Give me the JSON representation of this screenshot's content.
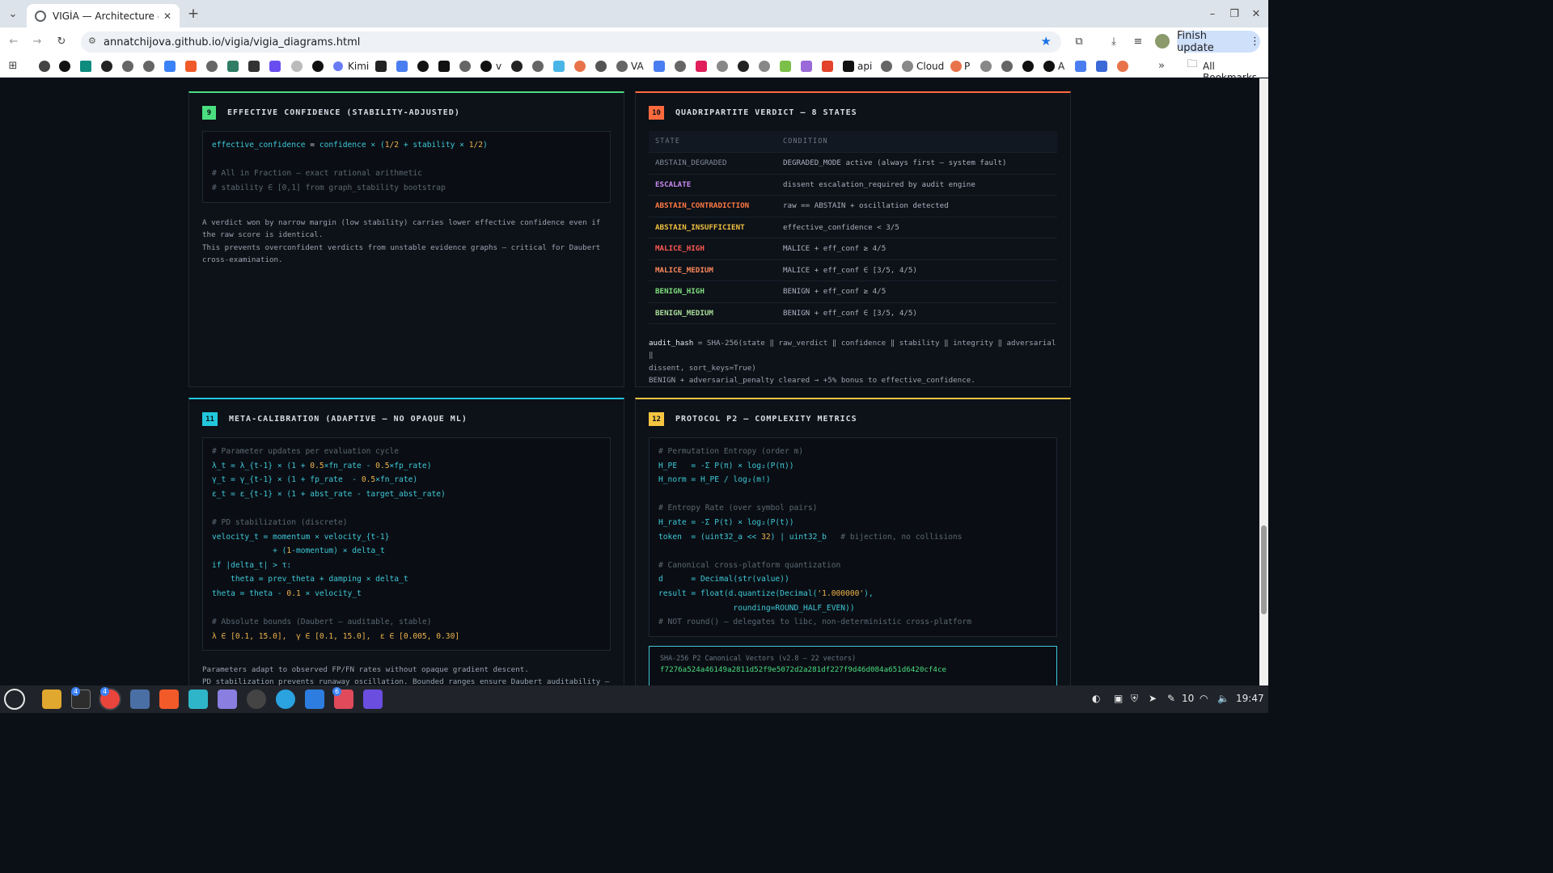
{
  "browser": {
    "tab_title": "VIGÍA — Architecture & Math",
    "url": "annatchijova.github.io/vigia/vigia_diagrams.html",
    "finish_update": "Finish update",
    "all_bookmarks": "All Bookmarks",
    "bookmarks": [
      "Kimi",
      "v",
      "VA",
      "P",
      "api",
      "Cloud",
      "A"
    ]
  },
  "panel9": {
    "num": "9",
    "title": "EFFECTIVE CONFIDENCE (STABILITY-ADJUSTED)",
    "code": {
      "l1a": "effective_confidence",
      "l1b": " = ",
      "l1c": "confidence × (",
      "l1d": "1/2",
      "l1e": " + stability × ",
      "l1f": "1/2",
      "l1g": ")",
      "c1": "# All in Fraction — exact rational arithmetic",
      "c2": "# stability ∈ [0,1] from graph_stability bootstrap"
    },
    "desc1": "A verdict won by narrow margin (low stability) carries lower effective confidence even if the raw score is identical.",
    "desc2": "This prevents overconfident verdicts from unstable evidence graphs — critical for Daubert cross-examination."
  },
  "panel10": {
    "num": "10",
    "title": "QUADRIPARTITE VERDICT — 8 STATES",
    "col_state": "STATE",
    "col_condition": "CONDITION",
    "rows": [
      {
        "state": "ABSTAIN_DEGRADED",
        "condition": "DEGRADED_MODE active (always first — system fault)",
        "color": "#7f8a99"
      },
      {
        "state": "ESCALATE",
        "condition": "dissent escalation_required by audit engine",
        "color": "#c98cf0"
      },
      {
        "state": "ABSTAIN_CONTRADICTION",
        "condition": "raw == ABSTAIN + oscillation detected",
        "color": "#ff7a45"
      },
      {
        "state": "ABSTAIN_INSUFFICIENT",
        "condition": "effective_confidence < 3/5",
        "color": "#f0c040"
      },
      {
        "state": "MALICE_HIGH",
        "condition": "MALICE + eff_conf ≥ 4/5",
        "color": "#ff5a52"
      },
      {
        "state": "MALICE_MEDIUM",
        "condition": "MALICE + eff_conf ∈ [3/5, 4/5)",
        "color": "#ff8a5c"
      },
      {
        "state": "BENIGN_HIGH",
        "condition": "BENIGN + eff_conf ≥ 4/5",
        "color": "#7ee07e"
      },
      {
        "state": "BENIGN_MEDIUM",
        "condition": "BENIGN + eff_conf ∈ [3/5, 4/5)",
        "color": "#a9dd9a"
      }
    ],
    "audit_key": "audit_hash",
    "audit_rest": " = SHA-256(state ‖ raw_verdict ‖ confidence ‖ stability ‖ integrity ‖ adversarial ‖",
    "audit_line2": "dissent, sort_keys=True)",
    "audit_line3": "BENIGN + adversarial_penalty cleared → +5% bonus to effective_confidence."
  },
  "panel11": {
    "num": "11",
    "title": "META-CALIBRATION (ADAPTIVE — NO OPAQUE ML)",
    "code": {
      "c1": "# Parameter updates per evaluation cycle",
      "l1a": "λ_t = λ_{t-1} × (1 + ",
      "l1b": "0.5",
      "l1c": "×fn_rate - ",
      "l1d": "0.5",
      "l1e": "×fp_rate)",
      "l2a": "γ_t = γ_{t-1} × (1 + fp_rate  - ",
      "l2b": "0.5",
      "l2c": "×fn_rate)",
      "l3": "ε_t = ε_{t-1} × (1 + abst_rate - target_abst_rate)",
      "c2": "# PD stabilization (discrete)",
      "l4": "velocity_t = momentum × velocity_{t-1}",
      "l5a": "             + (",
      "l5b": "1",
      "l5c": "-momentum) × delta_t",
      "l6": "if |delta_t| > τ:",
      "l7": "    theta = prev_theta + damping × delta_t",
      "l8a": "theta = theta - ",
      "l8b": "0.1",
      "l8c": " × velocity_t",
      "c3": "# Absolute bounds (Daubert — auditable, stable)",
      "l9": "λ ∈ [0.1, 15.0],  γ ∈ [0.1, 15.0],  ε ∈ [0.005, 0.30]"
    },
    "desc1": "Parameters adapt to observed FP/FN rates without opaque gradient descent.",
    "desc2": "PD stabilization prevents runaway oscillation. Bounded ranges ensure Daubert auditability —"
  },
  "panel12": {
    "num": "12",
    "title": "PROTOCOL P2 — COMPLEXITY METRICS",
    "code": {
      "c1": "# Permutation Entropy (order m)",
      "l1": "H_PE   = -Σ P(π) × log₂(P(π))",
      "l2": "H_norm = H_PE / log₂(m!)",
      "c2": "# Entropy Rate (over symbol pairs)",
      "l3": "H_rate = -Σ P(t) × log₂(P(t))",
      "l4a": "token  = (uint32_a << ",
      "l4b": "32",
      "l4c": ") | uint32_b",
      "l4d": "   # bijection, no collisions",
      "c3": "# Canonical cross-platform quantization",
      "l5": "d      = Decimal(str(value))",
      "l6a": "result = float(d.quantize(Decimal(",
      "l6b": "'1.000000'",
      "l6c": "),",
      "l7": "                rounding=ROUND_HALF_EVEN))",
      "c4": "# NOT round() — delegates to libc, non-deterministic cross-platform"
    },
    "hash_label": "SHA-256 P2 Canonical Vectors (v2.8 — 22 vectors)",
    "hash_value": "f7276a524a46149a2811d52f9e5072d2a281df227f9d46d084a651d6420cf4ce"
  },
  "taskbar": {
    "badge1": "4",
    "badge2": "4",
    "badge3": "6",
    "battery": "10",
    "clock": "19:47"
  }
}
